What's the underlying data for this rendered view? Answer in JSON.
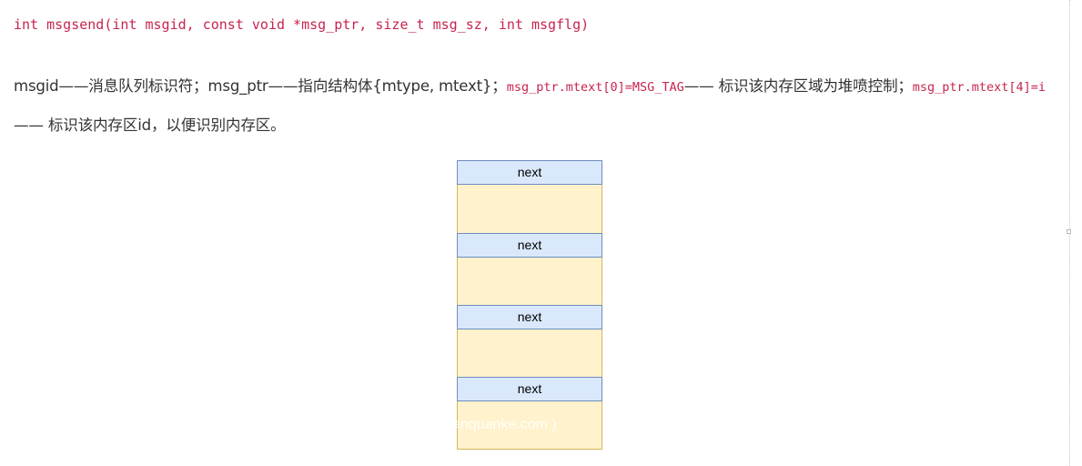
{
  "code": {
    "signature": "int msgsend(int msgid, const void *msg_ptr, size_t msg_sz, int msgflg)"
  },
  "paragraph": {
    "part1": "msgid——消息队列标识符；msg_ptr——指向结构体{mtype, mtext}；",
    "code1": "msg_ptr.mtext[0]=MSG_TAG",
    "part2": "—— 标识该内存区域为堆喷控制；",
    "code2": "msg_ptr.mtext[4]=i",
    "part3": "—— 标识该内存区id，以便识别内存区。"
  },
  "diagram": {
    "segments": [
      {
        "label": "next"
      },
      {
        "label": "next"
      },
      {
        "label": "next"
      },
      {
        "label": "next"
      }
    ],
    "colors": {
      "header_fill": "#dae8fc",
      "header_stroke": "#6c8ebf",
      "body_fill": "#fff2cc",
      "body_stroke": "#d6b656"
    }
  },
  "watermark": {
    "text": "anquanke.com )"
  }
}
